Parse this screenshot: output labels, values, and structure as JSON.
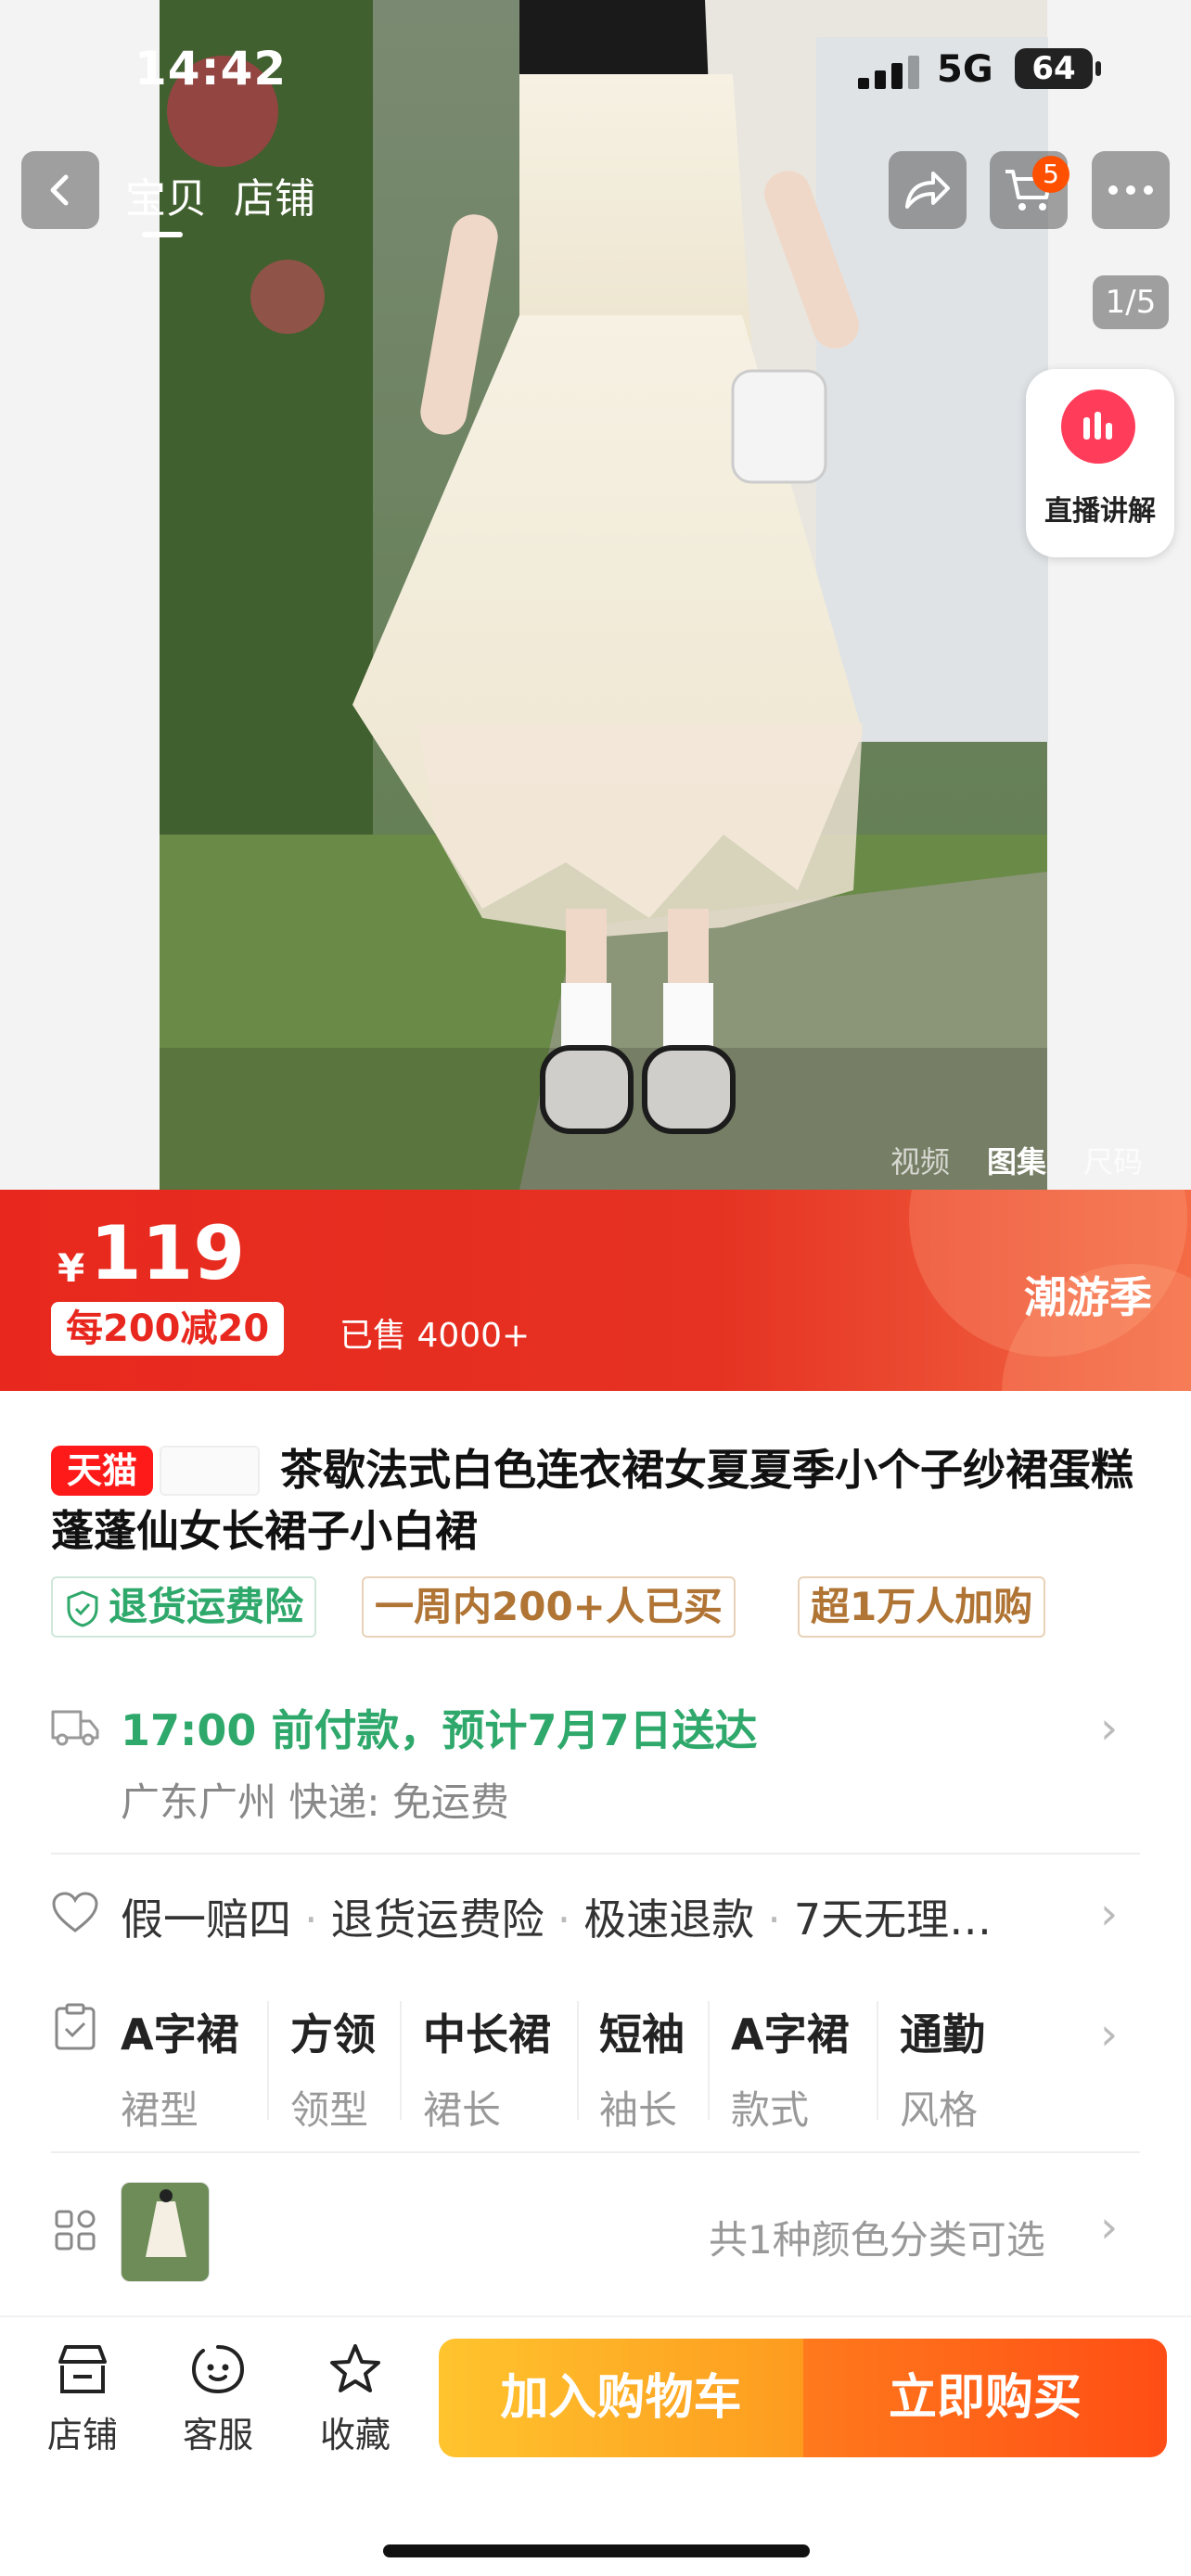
{
  "status_bar": {
    "time": "14:42",
    "network": "5G",
    "battery": "64"
  },
  "nav": {
    "tab_item": "宝贝",
    "tab_shop": "店铺",
    "cart_count": "5"
  },
  "gallery": {
    "counter": "1/5",
    "live_label": "直播讲解",
    "tabs": [
      "视频",
      "图集",
      "尺码"
    ],
    "active_tab": "图集"
  },
  "price": {
    "currency": "¥",
    "amount": "119",
    "coupon": "每200减20",
    "sold": "已售 4000+",
    "campaign": "潮游季"
  },
  "product": {
    "badge": "天猫",
    "title": "茶歇法式白色连衣裙女夏夏季小个子纱裙蛋糕蓬蓬仙女长裙子小白裙"
  },
  "tags": [
    "退货运费险",
    "一周内200+人已买",
    "超1万人加购"
  ],
  "delivery": {
    "line": "17:00 前付款，预计7月7日送达",
    "detail": "广东广州  快递: 免运费"
  },
  "guarantees": [
    "假一赔四",
    "退货运费险",
    "极速退款",
    "7天无理…"
  ],
  "attributes": [
    {
      "value": "A字裙",
      "key": "裙型"
    },
    {
      "value": "方领",
      "key": "领型"
    },
    {
      "value": "中长裙",
      "key": "裙长"
    },
    {
      "value": "短袖",
      "key": "袖长"
    },
    {
      "value": "A字裙",
      "key": "款式"
    },
    {
      "value": "通勤",
      "key": "风格"
    }
  ],
  "variants": {
    "summary": "共1种颜色分类可选"
  },
  "bottom_bar": {
    "shop": "店铺",
    "service": "客服",
    "favorite": "收藏",
    "add_to_cart": "加入购物车",
    "buy_now": "立即购买"
  },
  "colors": {
    "accent_red": "#e8281e",
    "tmall_red": "#ff1a1a",
    "green": "#2fa86b",
    "cart_yellow": "#ffc42e",
    "buy_orange": "#ff4d15"
  }
}
